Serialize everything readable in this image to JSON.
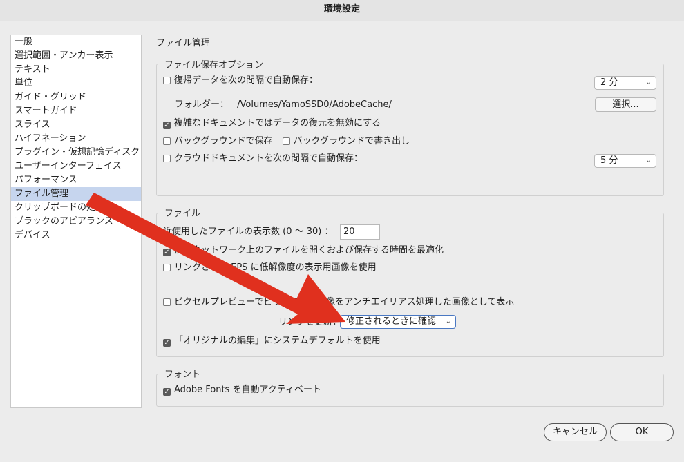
{
  "window": {
    "title": "環境設定"
  },
  "sidebar": {
    "items": [
      {
        "label": "一般"
      },
      {
        "label": "選択範囲・アンカー表示"
      },
      {
        "label": "テキスト"
      },
      {
        "label": "単位"
      },
      {
        "label": "ガイド・グリッド"
      },
      {
        "label": "スマートガイド"
      },
      {
        "label": "スライス"
      },
      {
        "label": "ハイフネーション"
      },
      {
        "label": "プラグイン・仮想記憶ディスク"
      },
      {
        "label": "ユーザーインターフェイス"
      },
      {
        "label": "パフォーマンス"
      },
      {
        "label": "ファイル管理"
      },
      {
        "label": "クリップボードの処理"
      },
      {
        "label": "ブラックのアピアランス"
      },
      {
        "label": "デバイス"
      }
    ],
    "selected_index": 11
  },
  "main": {
    "section_title": "ファイル管理",
    "save_options": {
      "legend": "ファイル保存オプション",
      "autosave_label": "復帰データを次の間隔で自動保存：",
      "autosave_checked": false,
      "autosave_interval": "2 分",
      "folder_label": "フォルダー：",
      "folder_path": "/Volumes/YamoSSD0/AdobeCache/",
      "choose_button": "選択...",
      "disable_recovery_label": "複雑なドキュメントではデータの復元を無効にする",
      "disable_recovery_checked": true,
      "bg_save_label": "バックグラウンドで保存",
      "bg_save_checked": false,
      "bg_export_label": "バックグラウンドで書き出し",
      "bg_export_checked": false,
      "cloud_autosave_label": "クラウドドキュメントを次の間隔で自動保存：",
      "cloud_autosave_checked": false,
      "cloud_interval": "5 分"
    },
    "files": {
      "legend": "ファイル",
      "recent_label": "近使用したファイルの表示数 (0 〜 30) ：",
      "recent_value": "20",
      "optimize_label": "低速ネットワーク上のファイルを開くおよび保存する時間を最適化",
      "optimize_checked": true,
      "lowres_label": "リンクされた EPS に低解像度の表示用画像を使用",
      "lowres_checked": false,
      "pixel_preview_label": "ピクセルプレビューでビットマップ画像をアンチエイリアス処理した画像として表示",
      "pixel_preview_checked": false,
      "update_links_label": "リンクを更新：",
      "update_links_value": "修正されるときに確認",
      "system_default_label": "「オリジナルの編集」にシステムデフォルトを使用",
      "system_default_checked": true
    },
    "fonts": {
      "legend": "フォント",
      "adobe_fonts_label": "Adobe Fonts を自動アクティベート",
      "adobe_fonts_checked": true
    }
  },
  "footer": {
    "cancel": "キャンセル",
    "ok": "OK"
  },
  "colors": {
    "arrow": "#e0301e",
    "selection": "#c6d5ee"
  },
  "check_glyph": "✓",
  "select_chevron": "⌄"
}
